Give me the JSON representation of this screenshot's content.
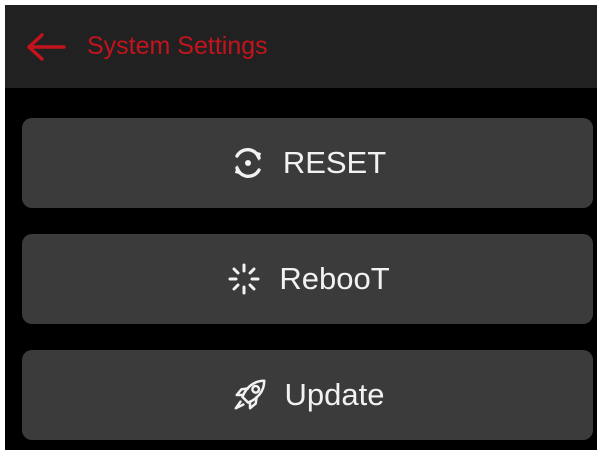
{
  "header": {
    "back_icon": "arrow-left-icon",
    "title": "System Settings",
    "accent_color": "#c3141d"
  },
  "buttons": [
    {
      "label": "RESET",
      "icon": "refresh-icon"
    },
    {
      "label": "RebooT",
      "icon": "loading-spinner-icon"
    },
    {
      "label": "Update",
      "icon": "rocket-icon"
    }
  ],
  "colors": {
    "background": "#000000",
    "header_bg": "#212121",
    "button_bg": "#3b3b3b",
    "button_text": "#f2f2f2"
  }
}
